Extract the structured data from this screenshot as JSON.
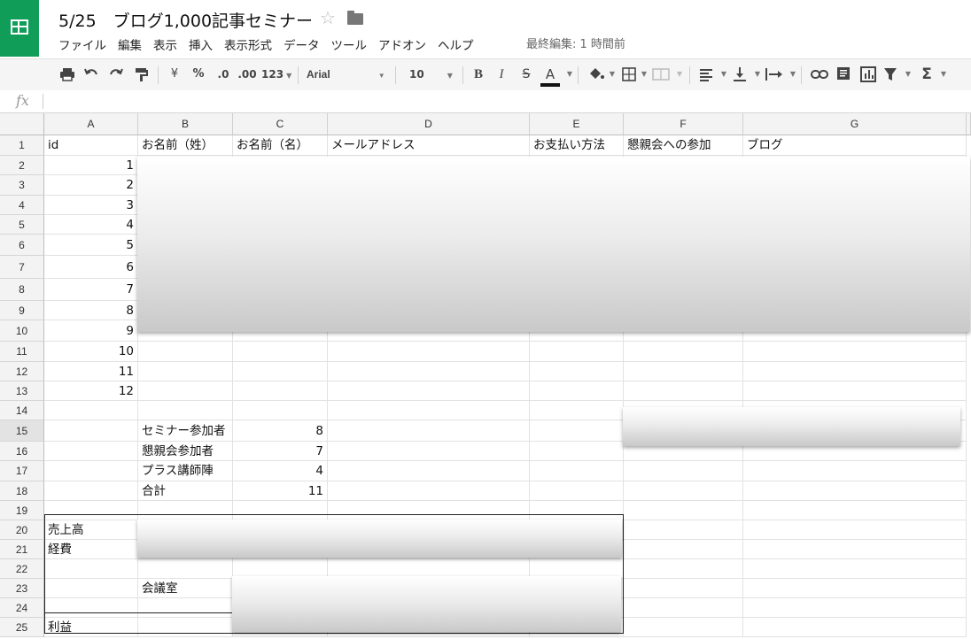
{
  "app": {
    "doc_title": "5/25　ブログ1,000記事セミナー",
    "star_glyph": "☆",
    "last_edit": "最終編集: 1 時間前"
  },
  "menu": [
    "ファイル",
    "編集",
    "表示",
    "挿入",
    "表示形式",
    "データ",
    "ツール",
    "アドオン",
    "ヘルプ"
  ],
  "toolbar": {
    "currency": "¥",
    "percent": "%",
    "decrease_decimals": ".0",
    "increase_decimals": ".00",
    "more_formats": "123",
    "font": "Arial",
    "font_size": "10",
    "bold": "B",
    "italic": "I",
    "strikethrough": "S",
    "text_color": "A",
    "sum": "Σ"
  },
  "formula_bar": {
    "label": "fx",
    "value": ""
  },
  "columns": [
    "A",
    "B",
    "C",
    "D",
    "E",
    "F",
    "G"
  ],
  "rows": [
    "1",
    "2",
    "3",
    "4",
    "5",
    "6",
    "7",
    "8",
    "9",
    "10",
    "11",
    "12",
    "13",
    "14",
    "15",
    "16",
    "17",
    "18",
    "19",
    "20",
    "21",
    "22",
    "23",
    "24",
    "25"
  ],
  "sheet": {
    "header_row": [
      "id",
      "お名前（姓）",
      "お名前（名）",
      "メールアドレス",
      "お支払い方法",
      "懇親会への参加",
      "ブログ"
    ],
    "ids": [
      "1",
      "2",
      "3",
      "4",
      "5",
      "6",
      "7",
      "8",
      "9",
      "10",
      "11",
      "12"
    ],
    "summary_labels": [
      "セミナー参加者",
      "懇親会参加者",
      "プラス講師陣",
      "合計"
    ],
    "summary_values": [
      "8",
      "7",
      "4",
      "11"
    ],
    "finance_labels": {
      "sales": "売上高",
      "expenses": "経費",
      "room": "会議室",
      "profit": "利益"
    }
  },
  "selected_row": "15"
}
